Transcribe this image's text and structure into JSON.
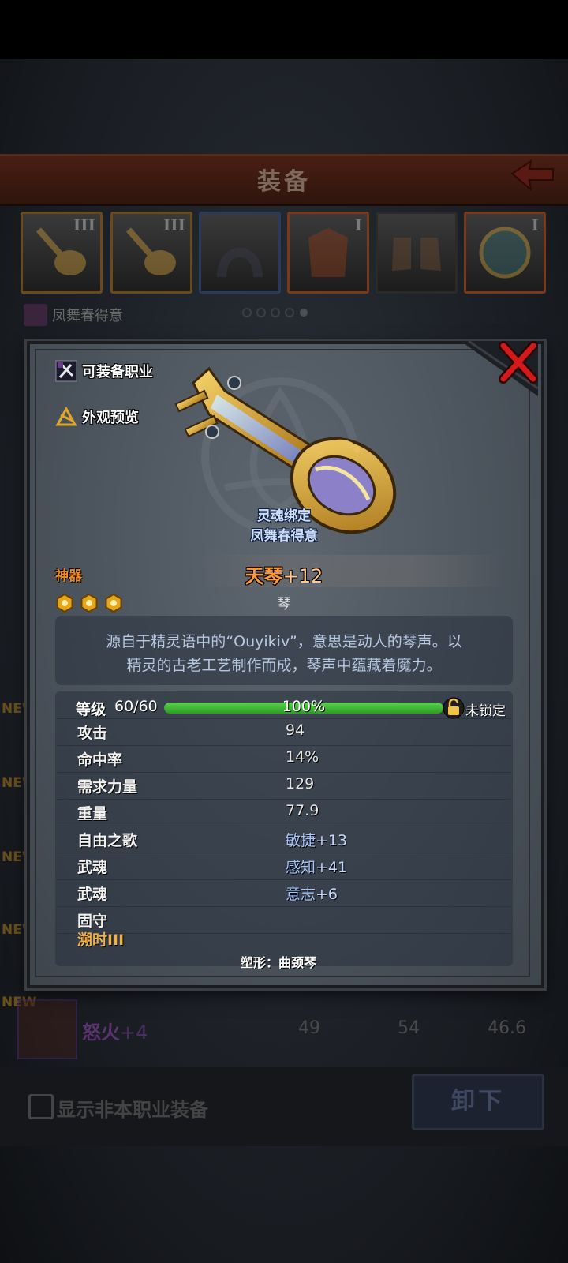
{
  "header": {
    "title": "装备"
  },
  "equipment_slots": [
    {
      "tier": "III",
      "icon": "lute-icon",
      "border": "gold"
    },
    {
      "tier": "III",
      "icon": "lute-icon",
      "border": "gold"
    },
    {
      "tier": "",
      "icon": "hood-icon",
      "border": "blue"
    },
    {
      "tier": "I",
      "icon": "armor-icon",
      "border": "orange"
    },
    {
      "tier": "",
      "icon": "boots-icon",
      "border": "dark"
    },
    {
      "tier": "I",
      "icon": "amulet-icon",
      "border": "orange"
    }
  ],
  "set": {
    "name": "凤舞春得意"
  },
  "background_list": {
    "new_label": "NEW",
    "item": {
      "name": "怒火",
      "plus": "+4",
      "stat1": "49",
      "stat2": "54",
      "stat3": "46.6"
    }
  },
  "bottom": {
    "show_label": "显示非本职业装备",
    "unequip_label": "卸下"
  },
  "dialog": {
    "equip_class_label": "可装备职业",
    "appearance_label": "外观预览",
    "bind_line1": "灵魂绑定",
    "bind_line2": "凤舞春得意",
    "rarity": "神器",
    "item_name": "天琴",
    "item_plus": "+12",
    "stars": 3,
    "item_type": "琴",
    "description_line1": "源自于精灵语中的“Ouyikiv”，意思是动人的琴声。以",
    "description_line2": "精灵的古老工艺制作而成，琴声中蕴藏着魔力。",
    "level_label": "等级",
    "level_value": "60/60",
    "level_progress": 1.0,
    "level_percent": "100%",
    "lock_label": "未锁定",
    "stats": [
      {
        "name": "攻击",
        "value": "94",
        "style": "plain"
      },
      {
        "name": "命中率",
        "value": "14%",
        "style": "plain"
      },
      {
        "name": "需求力量",
        "value": "129",
        "style": "plain"
      },
      {
        "name": "重量",
        "value": "77.9",
        "style": "plain"
      },
      {
        "name": "自由之歌",
        "value_name": "敏捷",
        "value_num": "+13",
        "style": "blue"
      },
      {
        "name": "武魂",
        "value_name": "感知",
        "value_num": "+41",
        "style": "blue"
      },
      {
        "name": "武魂",
        "value_name": "意志",
        "value_num": "+6",
        "style": "blue"
      },
      {
        "name": "固守",
        "value": "",
        "style": "plain"
      }
    ],
    "last_row_label": "溯时III",
    "reshape_text": "塑形：曲颈琴"
  }
}
